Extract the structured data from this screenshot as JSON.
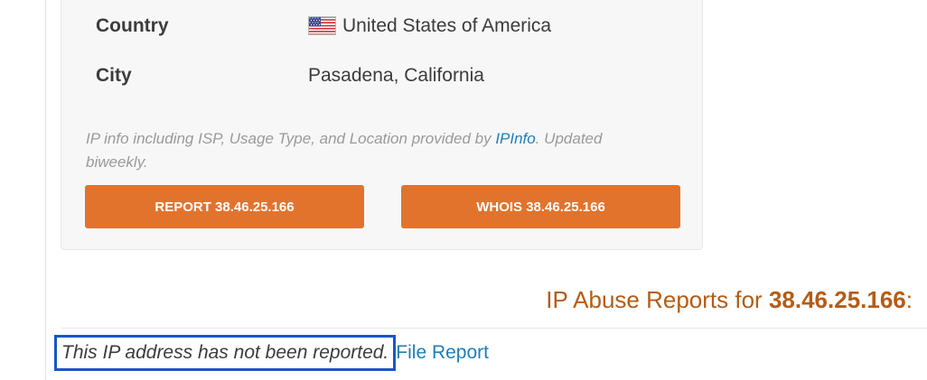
{
  "ip_card": {
    "country_label": "Country",
    "country_value": "United States of America",
    "country_flag_icon": "us-flag-icon",
    "city_label": "City",
    "city_value": "Pasadena, California",
    "note_prefix": "IP info including ISP, Usage Type, and Location provided by ",
    "note_link": "IPInfo",
    "note_suffix": ". Updated biweekly.",
    "report_button": "REPORT 38.46.25.166",
    "whois_button": "WHOIS 38.46.25.166"
  },
  "reports": {
    "heading_prefix": "IP Abuse Reports for ",
    "heading_ip": "38.46.25.166",
    "heading_suffix": ":",
    "status_text": "This IP address has not been reported.",
    "file_report_link": "File Report"
  },
  "colors": {
    "button_orange": "#e2732d",
    "heading_brown": "#b55c15",
    "link_blue": "#1d7fb8",
    "highlight_border": "#1a56c9"
  }
}
